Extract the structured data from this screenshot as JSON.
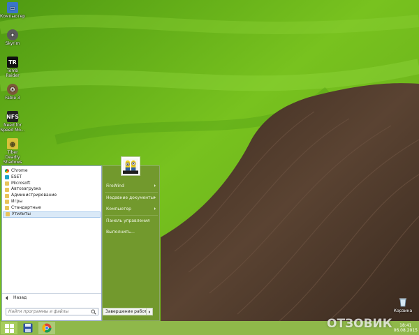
{
  "desktop": {
    "icons": [
      {
        "label": "Компьютер",
        "icon": "computer-icon",
        "color": "#3b76c7"
      },
      {
        "label": "Skyrim",
        "icon": "skyrim-icon",
        "color": "#5a5a5a"
      },
      {
        "label": "Tomb Raider",
        "icon": "tomb-raider-icon",
        "color": "#111111"
      },
      {
        "label": "Fable 3",
        "icon": "fable-icon",
        "color": "#7c5a38"
      },
      {
        "label": "Need for Speed Mo...",
        "icon": "nfs-icon",
        "color": "#222222"
      },
      {
        "label": "Tiber Deadly Shadows",
        "icon": "thief-icon",
        "color": "#d8c13a"
      }
    ],
    "recycle_bin_label": "Корзина"
  },
  "start_menu": {
    "programs": [
      {
        "label": "Chrome",
        "icon": "chrome"
      },
      {
        "label": "ESET",
        "icon": "eset"
      },
      {
        "label": "Microsoft",
        "icon": "folder"
      },
      {
        "label": "Автозагрузка",
        "icon": "folder"
      },
      {
        "label": "Администрирование",
        "icon": "folder"
      },
      {
        "label": "Игры",
        "icon": "folder"
      },
      {
        "label": "Стандартные",
        "icon": "folder"
      },
      {
        "label": "Утилиты",
        "icon": "folder",
        "selected": true
      }
    ],
    "back_label": "Назад",
    "search_placeholder": "Найти программы и файлы",
    "right_items": {
      "user": "FireWind",
      "recent": "Недавние документы",
      "computer": "Компьютер",
      "control_panel": "Панель управления",
      "run": "Выполнить..."
    },
    "shutdown_label": "Завершение работы"
  },
  "taskbar": {
    "time": "18:41",
    "date": "06.08.2015"
  },
  "watermark": "ОТЗОВИК",
  "colors": {
    "menu_green": "#72992d",
    "taskbar": "#8fb84a",
    "selection": "#dae9f7"
  }
}
